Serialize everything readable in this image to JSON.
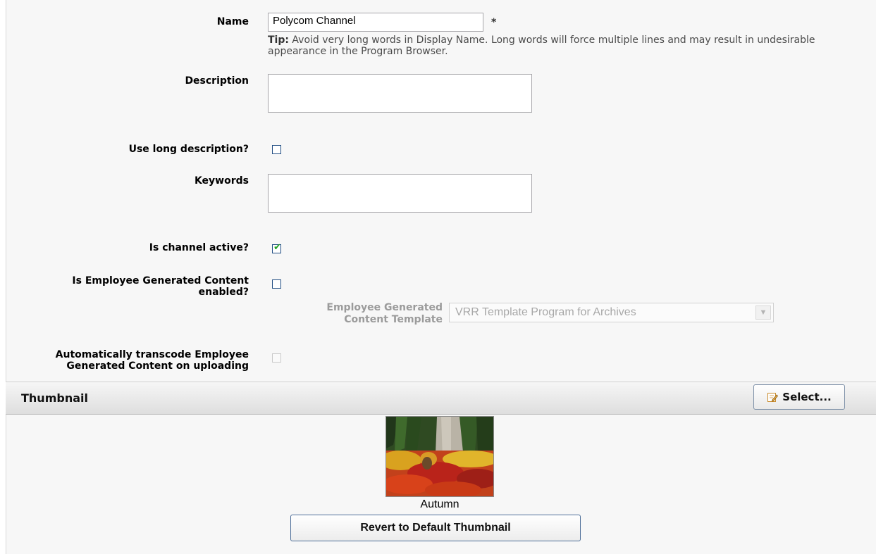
{
  "form": {
    "name_label": "Name",
    "name_value": "Polycom Channel",
    "required_mark": "*",
    "tip_prefix": "Tip:",
    "tip_text": "Avoid very long words in Display Name. Long words will force multiple lines and may result in undesirable appearance in the Program Browser.",
    "description_label": "Description",
    "description_value": "",
    "long_desc_label": "Use long description?",
    "long_desc_checked": false,
    "keywords_label": "Keywords",
    "keywords_value": "",
    "active_label": "Is channel active?",
    "active_checked": true,
    "egc_label_line1": "Is Employee Generated Content",
    "egc_label_line2": "enabled?",
    "egc_checked": false,
    "egc_template_label_line1": "Employee Generated",
    "egc_template_label_line2": "Content Template",
    "egc_template_value": "VRR Template Program for Archives",
    "transcode_label_line1": "Automatically transcode Employee",
    "transcode_label_line2": "Generated Content on uploading",
    "transcode_checked": false
  },
  "thumbnail": {
    "section_title": "Thumbnail",
    "select_label": "Select...",
    "image_caption": "Autumn",
    "revert_label": "Revert to Default Thumbnail"
  },
  "colors": {
    "checkbox_border": "#1f4c82",
    "check_mark": "#21a121",
    "disabled_text": "#9b9b9b"
  }
}
